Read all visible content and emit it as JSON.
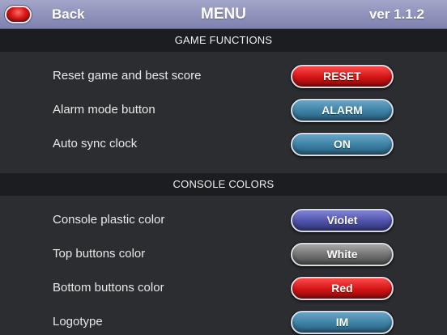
{
  "header": {
    "back_label": "Back",
    "title": "MENU",
    "version": "ver 1.1.2"
  },
  "sections": [
    {
      "title": "GAME FUNCTIONS",
      "rows": [
        {
          "label": "Reset game and best score",
          "button": "RESET",
          "button_color": "#d01414"
        },
        {
          "label": "Alarm mode button",
          "button": "ALARM",
          "button_color": "#3b7fa3"
        },
        {
          "label": "Auto sync clock",
          "button": "ON",
          "button_color": "#3b7fa3"
        }
      ]
    },
    {
      "title": "CONSOLE COLORS",
      "rows": [
        {
          "label": "Console plastic color",
          "button": "Violet",
          "button_color": "#4d50a8"
        },
        {
          "label": "Top buttons color",
          "button": "White",
          "button_color": "#6f6f6f"
        },
        {
          "label": "Bottom buttons color",
          "button": "Red",
          "button_color": "#d01414"
        },
        {
          "label": "Logotype",
          "button": "IM",
          "button_color": "#3b7fa3"
        }
      ]
    }
  ],
  "colors": {
    "header_bar": "#8e91ba",
    "background": "#2b2d31",
    "section_header": "#1c1d21"
  }
}
